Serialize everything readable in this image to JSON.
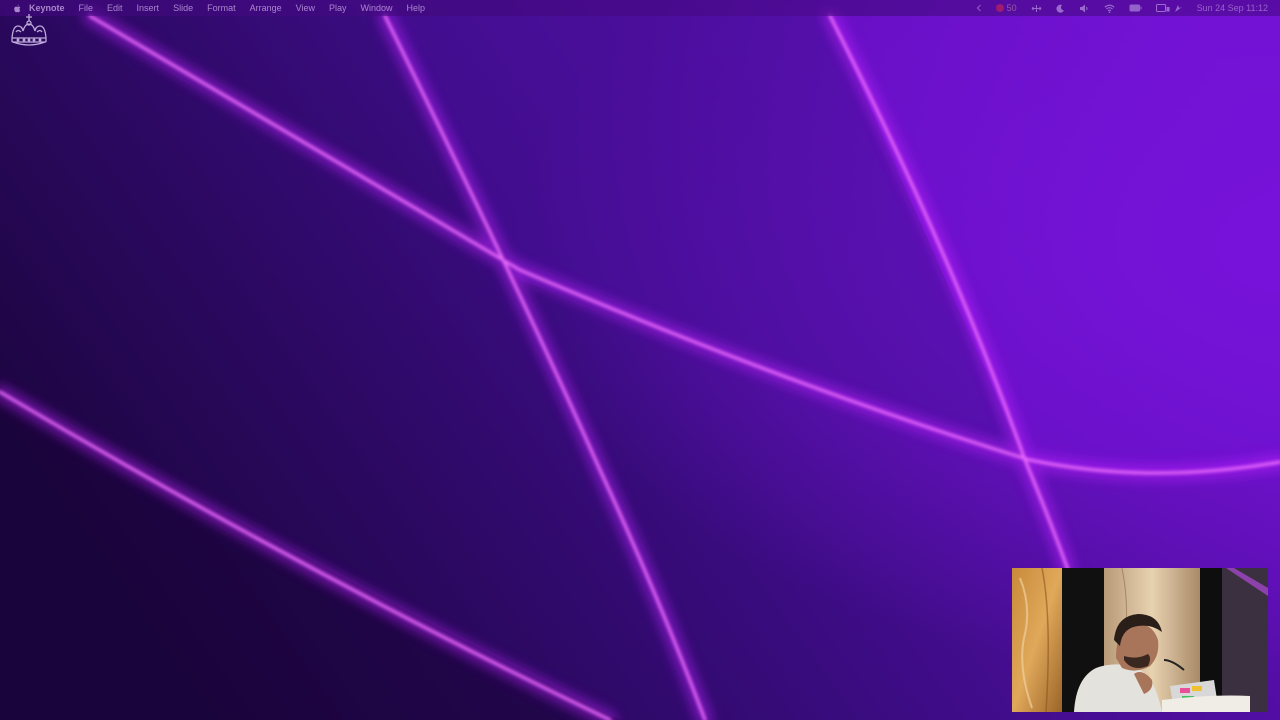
{
  "menubar": {
    "apple_icon": "apple-logo-icon",
    "app_name": "Keynote",
    "items": [
      "File",
      "Edit",
      "Insert",
      "Slide",
      "Format",
      "Arrange",
      "View",
      "Play",
      "Window",
      "Help"
    ],
    "status": {
      "chevron_icon": "chevron-left-icon",
      "record_value": "50",
      "icons": [
        "move-icon",
        "moon-icon",
        "speaker-icon",
        "wifi-icon",
        "battery-icon",
        "control-center-icon",
        "siri-icon"
      ],
      "clock": "Sun 24 Sep  11:12"
    }
  },
  "overlay": {
    "logo_icon": "crown-logo-icon"
  },
  "wallpaper": {
    "colors": {
      "dark": "#1e0640",
      "mid": "#4a0f96",
      "bright": "#7a10d8",
      "glow": "#e040ff"
    }
  },
  "pip": {
    "description_icon": "presenter-video-icon"
  }
}
